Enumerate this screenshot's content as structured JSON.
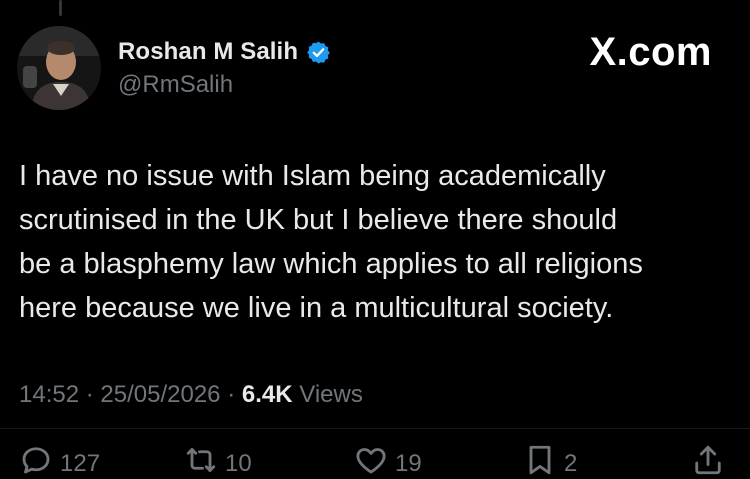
{
  "author": {
    "display_name": "Roshan M Salih",
    "handle": "@RmSalih",
    "verified": true
  },
  "brand": "X.com",
  "tweet": {
    "lines": [
      "I have no issue with Islam being academically",
      "scrutinised in the UK but I believe there should",
      "be a blasphemy law which applies to all religions",
      "here because we live in a multicultural society."
    ]
  },
  "meta": {
    "time": "14:52",
    "separator": "·",
    "date": "25/05/2026",
    "views_count": "6.4K",
    "views_label": "Views"
  },
  "actions": {
    "replies": "127",
    "reposts": "10",
    "likes": "19",
    "bookmarks": "2"
  },
  "colors": {
    "background": "#000000",
    "text": "#e7e9ea",
    "muted": "#71767b",
    "verified": "#1d9bf0"
  }
}
